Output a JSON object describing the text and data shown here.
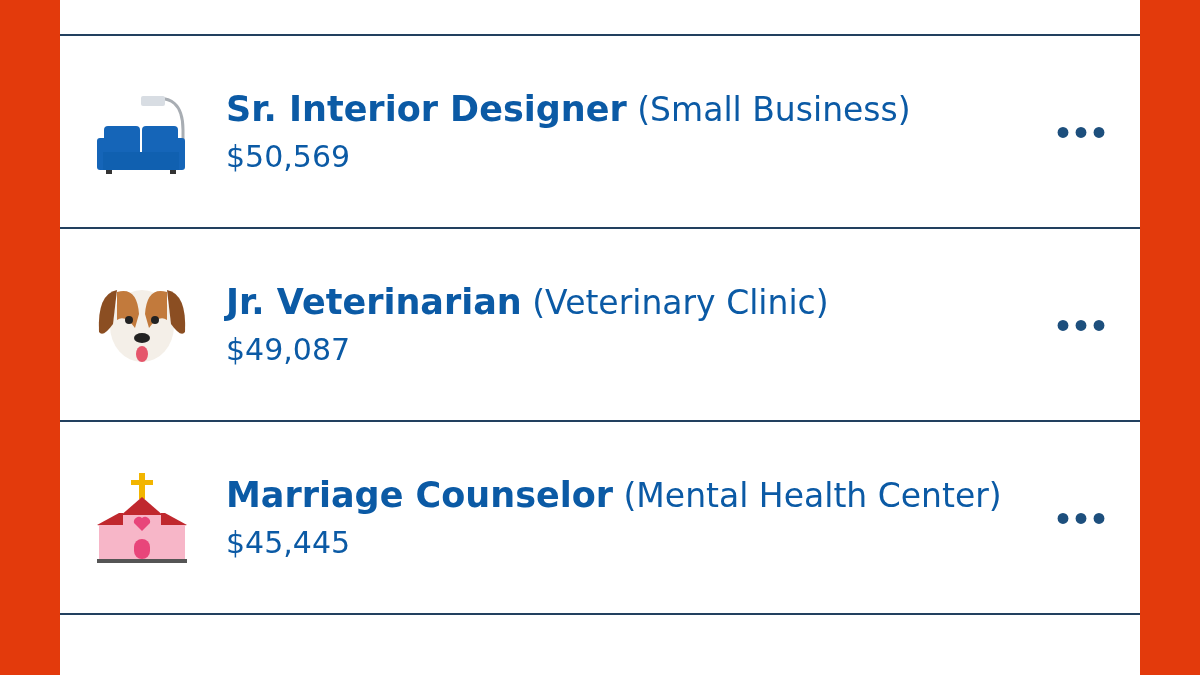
{
  "jobs": [
    {
      "kind": "sofa",
      "title": "Sr. Interior Designer",
      "employer": "(Small Business)",
      "salary": "$50,569",
      "more": "•••"
    },
    {
      "kind": "dog",
      "title": "Jr. Veterinarian",
      "employer": "(Veterinary Clinic)",
      "salary": "$49,087",
      "more": "•••"
    },
    {
      "kind": "chapel",
      "title": "Marriage Counselor",
      "employer": "(Mental Health Center)",
      "salary": "$45,445",
      "more": "•••"
    }
  ]
}
